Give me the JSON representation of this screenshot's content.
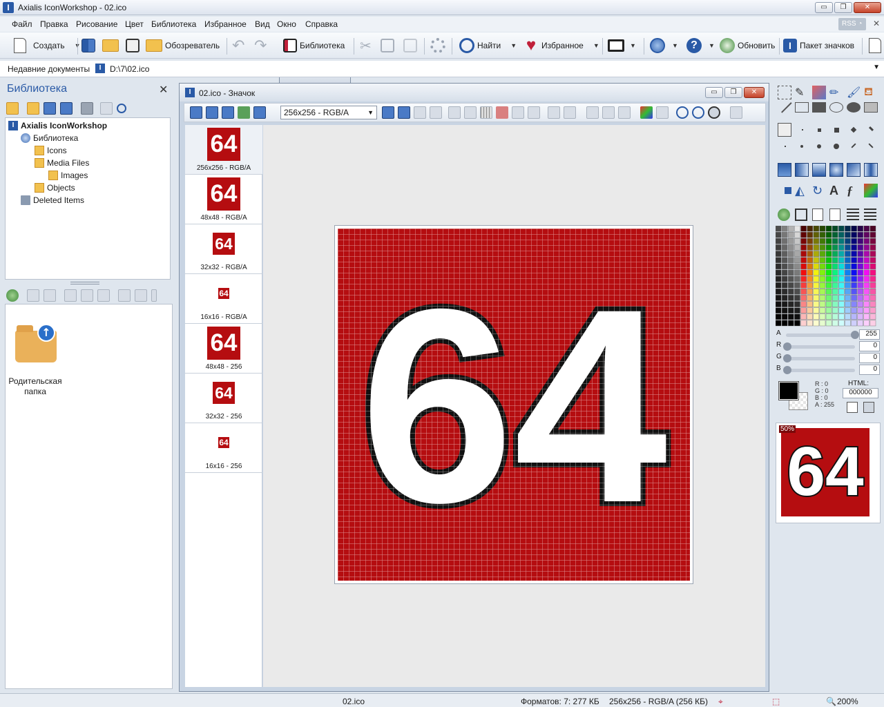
{
  "window": {
    "title": "Axialis IconWorkshop - 02.ico",
    "min_glyph": "▭",
    "max_glyph": "❐",
    "close_glyph": "✕"
  },
  "menu": [
    "Файл",
    "Правка",
    "Рисование",
    "Цвет",
    "Библиотека",
    "Избранное",
    "Вид",
    "Окно",
    "Справка"
  ],
  "menu_right": {
    "rss": "RSS",
    "close": "✕"
  },
  "toolbar": {
    "create": "Создать",
    "browser": "Обозреватель",
    "library": "Библиотека",
    "find": "Найти",
    "favorites": "Избранное",
    "update": "Обновить",
    "icon_pack": "Пакет значков"
  },
  "recent": {
    "label": "Недавние документы",
    "value": "D:\\7\\02.ico"
  },
  "library_panel": {
    "title": "Библиотека",
    "close": "✕",
    "tree": {
      "root": "Axialis IconWorkshop",
      "library": "Библиотека",
      "icons": "Icons",
      "media": "Media Files",
      "images": "Images",
      "objects": "Objects",
      "deleted": "Deleted Items"
    },
    "parent_folder": "Родительская папка"
  },
  "document": {
    "title": "02.ico - Значок",
    "format_select": "256x256 - RGB/A",
    "formats": [
      {
        "caption": "256x256 - RGB/A"
      },
      {
        "caption": "48x48 - RGB/A"
      },
      {
        "caption": "32x32 - RGB/A"
      },
      {
        "caption": "16x16 - RGB/A"
      },
      {
        "caption": "48x48 - 256"
      },
      {
        "caption": "32x32 - 256"
      },
      {
        "caption": "16x16 - 256"
      }
    ],
    "icon_text": "64"
  },
  "color_panel": {
    "labels": {
      "a": "A",
      "r": "R",
      "g": "G",
      "b": "B"
    },
    "values": {
      "a": "255",
      "r": "0",
      "g": "0",
      "b": "0"
    },
    "readout": {
      "r": "R : 0",
      "g": "G : 0",
      "b": "B : 0",
      "a": "A : 255"
    },
    "html_label": "HTML:",
    "html_value": "000000",
    "preview_zoom": "50%"
  },
  "status": {
    "file": "02.ico",
    "formats": "Форматов: 7: 277 КБ",
    "current": "256x256 - RGB/A (256 КБ)",
    "zoom": "200%"
  },
  "colors": {
    "icon_red": "#b50d10",
    "accent_blue": "#2a5aa6"
  }
}
